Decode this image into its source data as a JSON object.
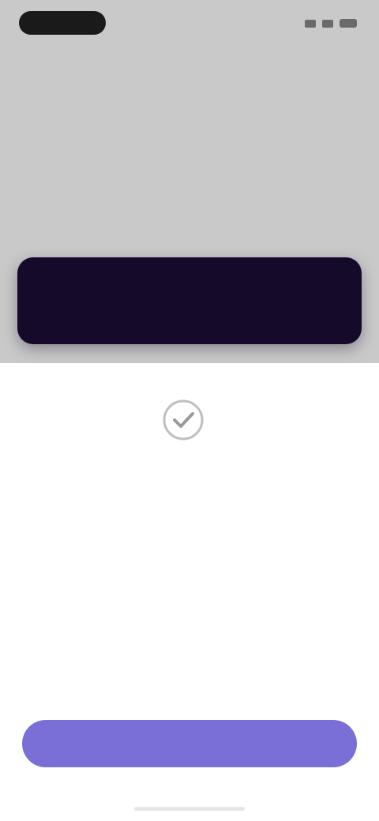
{
  "status_bar": {
    "time": ""
  },
  "prompt": {
    "question": ""
  },
  "confirmation": {
    "headline": "",
    "description": ""
  },
  "actions": {
    "primary_label": ""
  },
  "icons": {
    "status_signal": "signal-icon",
    "status_wifi": "wifi-icon",
    "status_battery": "battery-icon",
    "confirmation": "check-circle-icon"
  },
  "colors": {
    "top_background": "#c9c9c9",
    "dark_card": "#160a2b",
    "accent": "#7a6fd6",
    "page_background": "#ffffff"
  }
}
